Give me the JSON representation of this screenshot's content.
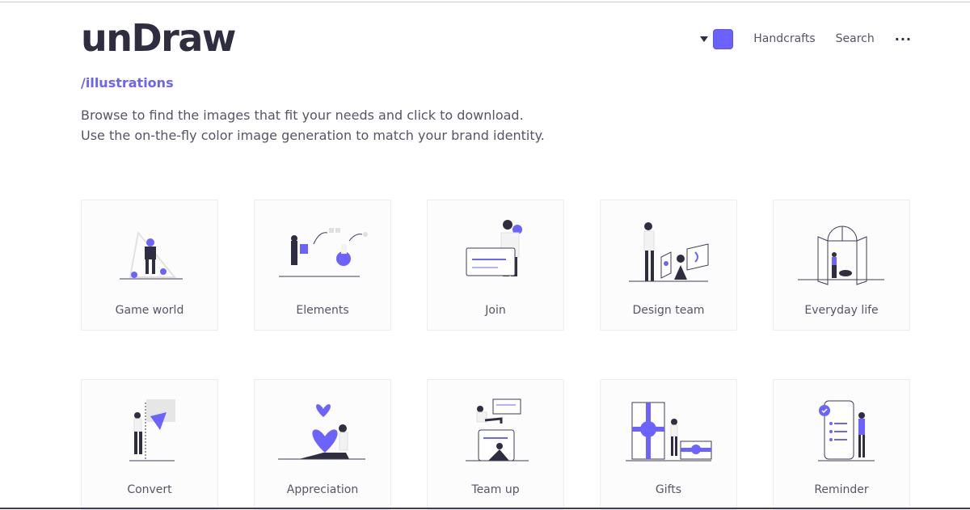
{
  "brand": {
    "logo": "unDraw",
    "subtitle": "/illustrations",
    "accent": "#6c63ff",
    "ink": "#2f2e41"
  },
  "nav": {
    "color_swatch": "#6c63ff",
    "links": [
      "Handcrafts",
      "Search"
    ],
    "more": "···"
  },
  "description": "Browse to find the images that fit your needs and click to download. Use the on-the-fly color image generation to match your brand identity.",
  "cards": [
    {
      "label": "Game world"
    },
    {
      "label": "Elements"
    },
    {
      "label": "Join"
    },
    {
      "label": "Design team"
    },
    {
      "label": "Everyday life"
    },
    {
      "label": "Convert"
    },
    {
      "label": "Appreciation"
    },
    {
      "label": "Team up"
    },
    {
      "label": "Gifts"
    },
    {
      "label": "Reminder"
    }
  ]
}
